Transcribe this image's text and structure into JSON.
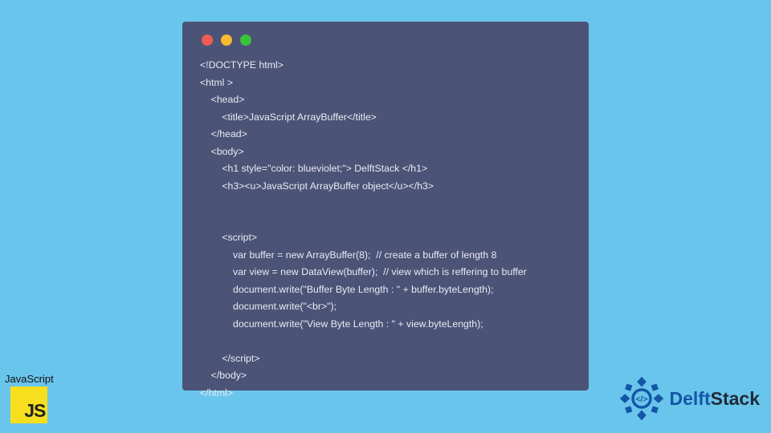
{
  "code_window": {
    "lines": [
      "<!DOCTYPE html>",
      "<html >",
      "    <head>",
      "        <title>JavaScript ArrayBuffer</title>",
      "    </head>",
      "    <body>",
      "        <h1 style=\"color: blueviolet;\"> DelftStack </h1>",
      "        <h3><u>JavaScript ArrayBuffer object</u></h3>",
      "",
      "",
      "        <script>",
      "            var buffer = new ArrayBuffer(8);  // create a buffer of length 8",
      "            var view = new DataView(buffer);  // view which is reffering to buffer",
      "            document.write(\"Buffer Byte Length : \" + buffer.byteLength);",
      "            document.write(\"<br>\");",
      "            document.write(\"View Byte Length : \" + view.byteLength);",
      "",
      "        </script>",
      "    </body>",
      "</html>"
    ],
    "dot_colors": {
      "red": "#ee5c54",
      "yellow": "#f5bb2e",
      "green": "#39c23c"
    }
  },
  "js_badge": {
    "label": "JavaScript",
    "logo_text": "JS"
  },
  "brand": {
    "name_first": "Delft",
    "name_second": "Stack"
  }
}
